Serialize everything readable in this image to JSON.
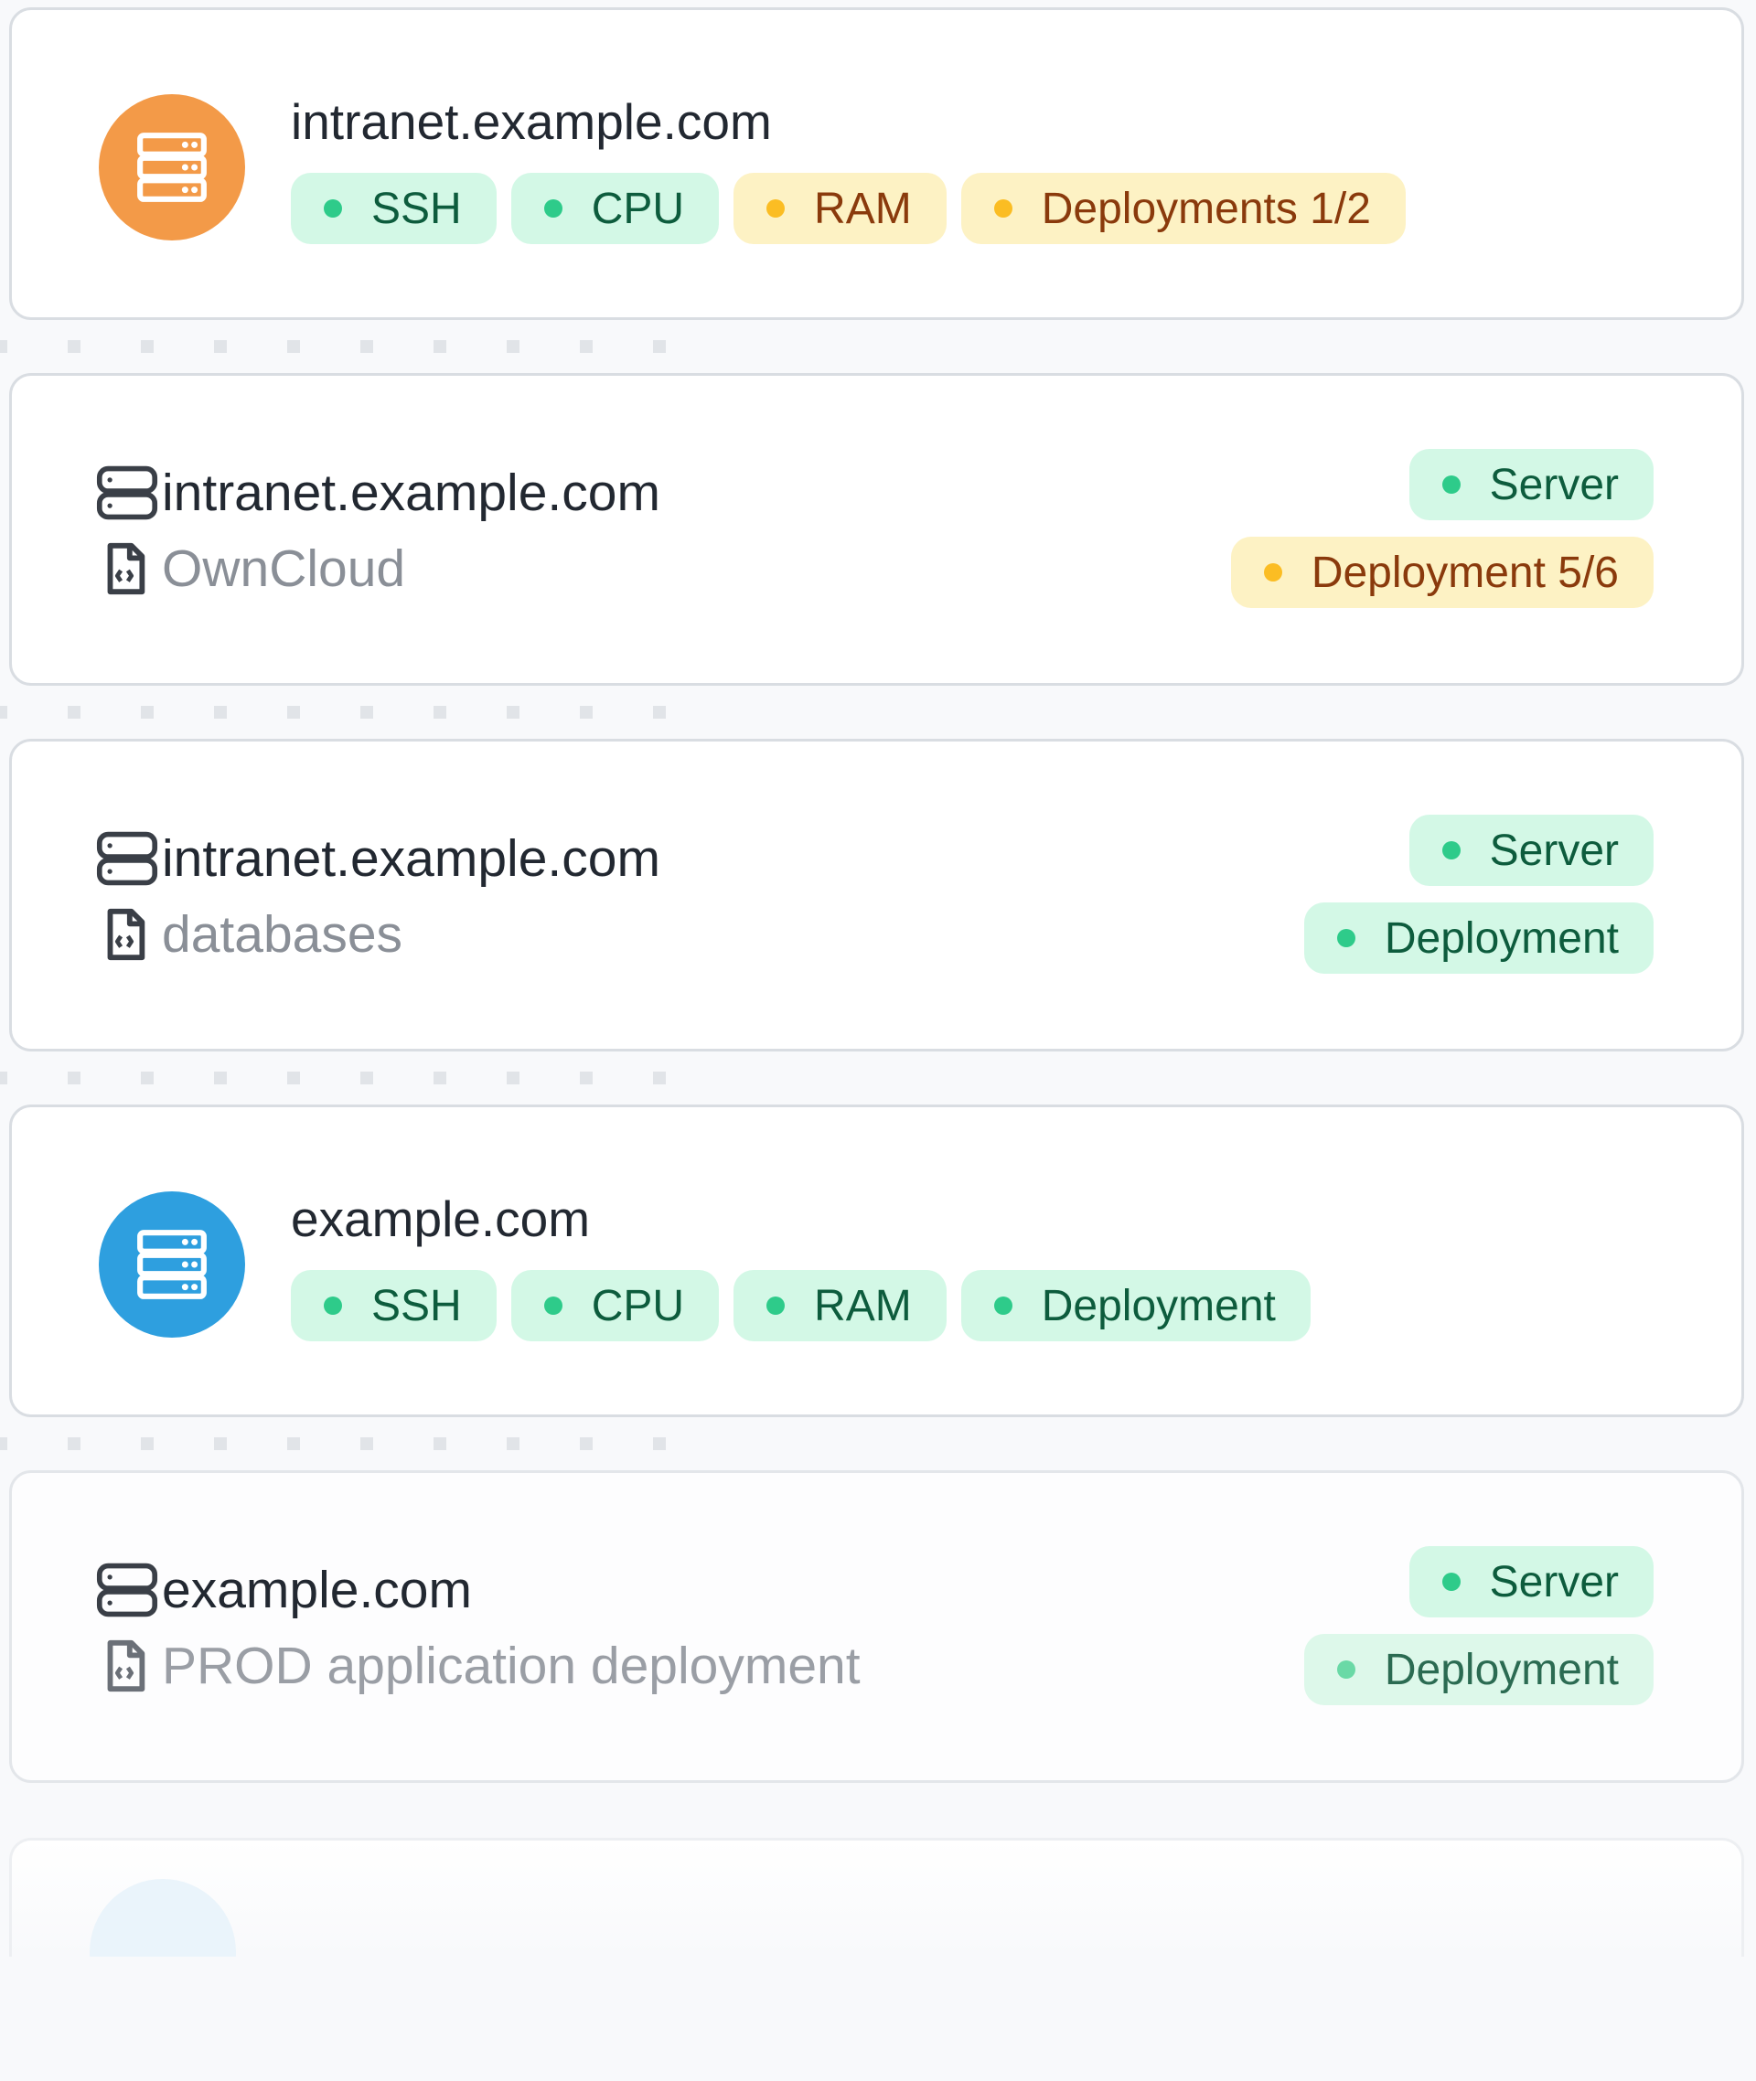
{
  "cards": [
    {
      "type": "server",
      "host": "intranet.example.com",
      "avatar_color": "#f39a48",
      "icon": "server-icon",
      "tags": [
        {
          "label": "SSH",
          "status": "ok"
        },
        {
          "label": "CPU",
          "status": "ok"
        },
        {
          "label": "RAM",
          "status": "warn"
        },
        {
          "label": "Deployments 1/2",
          "status": "warn"
        }
      ]
    },
    {
      "type": "deployment",
      "host": "intranet.example.com",
      "name": "OwnCloud",
      "host_icon": "server-icon",
      "name_icon": "code-file-icon",
      "statuses": [
        {
          "label": "Server",
          "status": "ok"
        },
        {
          "label": "Deployment 5/6",
          "status": "warn"
        }
      ]
    },
    {
      "type": "deployment",
      "host": "intranet.example.com",
      "name": "databases",
      "host_icon": "server-icon",
      "name_icon": "code-file-icon",
      "statuses": [
        {
          "label": "Server",
          "status": "ok"
        },
        {
          "label": "Deployment",
          "status": "ok"
        }
      ]
    },
    {
      "type": "server",
      "host": "example.com",
      "avatar_color": "#2e9fdf",
      "icon": "server-icon",
      "tags": [
        {
          "label": "SSH",
          "status": "ok"
        },
        {
          "label": "CPU",
          "status": "ok"
        },
        {
          "label": "RAM",
          "status": "ok"
        },
        {
          "label": "Deployment",
          "status": "ok"
        }
      ]
    },
    {
      "type": "deployment",
      "host": "example.com",
      "name": "PROD application deployment",
      "host_icon": "server-icon",
      "name_icon": "code-file-icon",
      "statuses": [
        {
          "label": "Server",
          "status": "ok"
        },
        {
          "label": "Deployment",
          "status": "ok"
        }
      ]
    }
  ],
  "colors": {
    "ok_bg": "#d3f8e6",
    "ok_text": "#0d5c3d",
    "ok_dot": "#2ecb8a",
    "warn_bg": "#fdf2c4",
    "warn_text": "#8a3a0c",
    "warn_dot": "#fbbd23"
  }
}
